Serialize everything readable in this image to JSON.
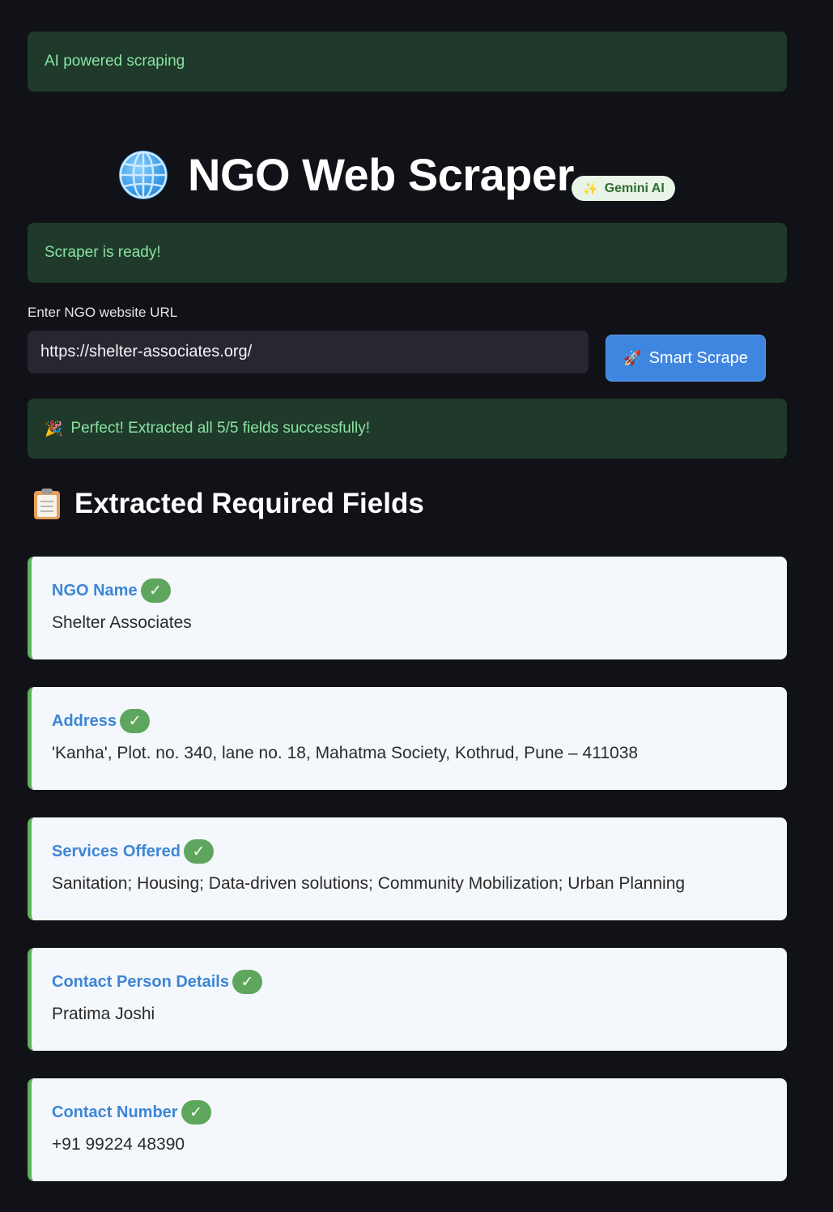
{
  "alerts": {
    "top": "AI powered scraping",
    "ready": "Scraper is ready!",
    "result_emoji": "🎉",
    "result": "Perfect! Extracted all 5/5 fields successfully!"
  },
  "header": {
    "title": "NGO Web Scraper",
    "badge_emoji": "✨",
    "badge": "Gemini AI"
  },
  "url_input": {
    "label": "Enter NGO website URL",
    "value": "https://shelter-associates.org/"
  },
  "scrape_button": {
    "emoji": "🚀",
    "label": "Smart Scrape",
    "color": "#3f86e0"
  },
  "section": {
    "heading": "Extracted Required Fields"
  },
  "fields": [
    {
      "label": "NGO Name",
      "check": "✓",
      "value": "Shelter Associates"
    },
    {
      "label": "Address",
      "check": "✓",
      "value": "'Kanha', Plot. no. 340, lane no. 18, Mahatma Society, Kothrud, Pune – 411038"
    },
    {
      "label": "Services Offered",
      "check": "✓",
      "value": "Sanitation; Housing; Data-driven solutions; Community Mobilization; Urban Planning"
    },
    {
      "label": "Contact Person Details",
      "check": "✓",
      "value": "Pratima Joshi"
    },
    {
      "label": "Contact Number",
      "check": "✓",
      "value": "+91 99224 48390"
    }
  ],
  "colors": {
    "background": "#111217",
    "success_bg": "#1f3a2b",
    "success_text": "#89e2a2",
    "field_label": "#3c86d6",
    "check_bg": "#5ea65d",
    "card_bg": "#f4f7fb"
  },
  "icons": {
    "title": "globe-icon",
    "section": "clipboard-icon"
  }
}
